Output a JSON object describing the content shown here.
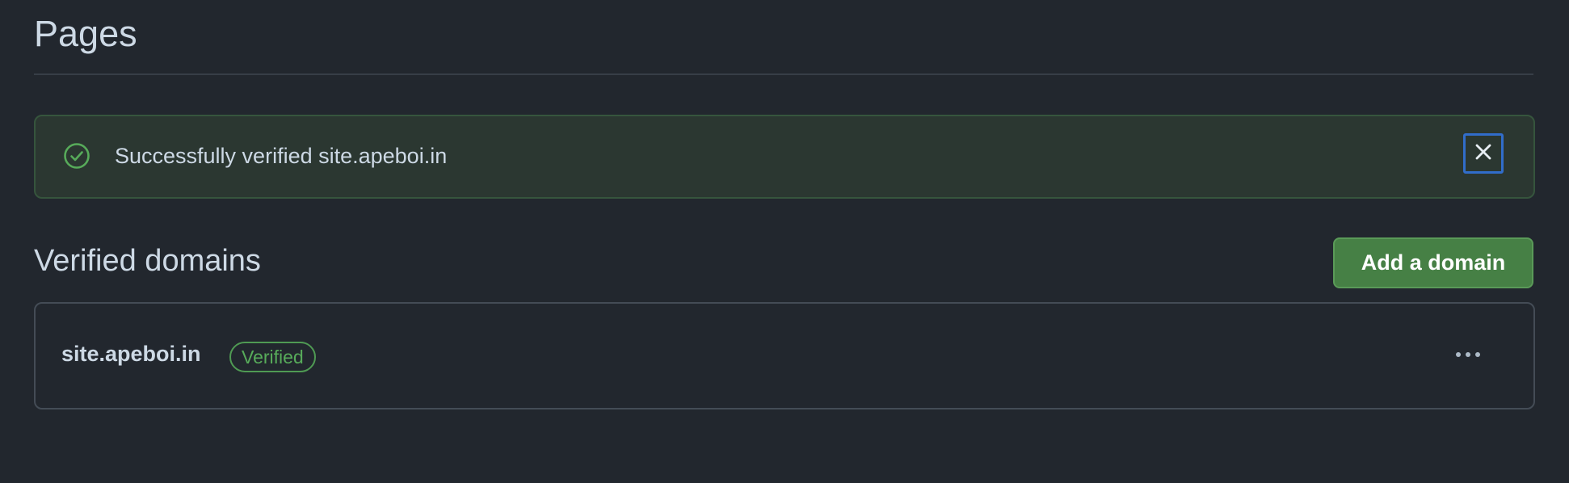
{
  "page": {
    "title": "Pages"
  },
  "flash": {
    "message": "Successfully verified site.apeboi.in",
    "icon": "check-circle-icon",
    "close_icon": "x-icon",
    "colors": {
      "background": "#2b3731",
      "border": "#36553d",
      "icon": "#57ab5a"
    }
  },
  "verified_domains": {
    "title": "Verified domains",
    "add_button_label": "Add a domain",
    "items": [
      {
        "domain": "site.apeboi.in",
        "status": "Verified",
        "menu_icon": "kebab-horizontal-icon"
      }
    ]
  },
  "colors": {
    "page_background": "#22272e",
    "primary_button": "#468045",
    "success_text": "#57ab5a",
    "focus_outline": "#316dca"
  }
}
